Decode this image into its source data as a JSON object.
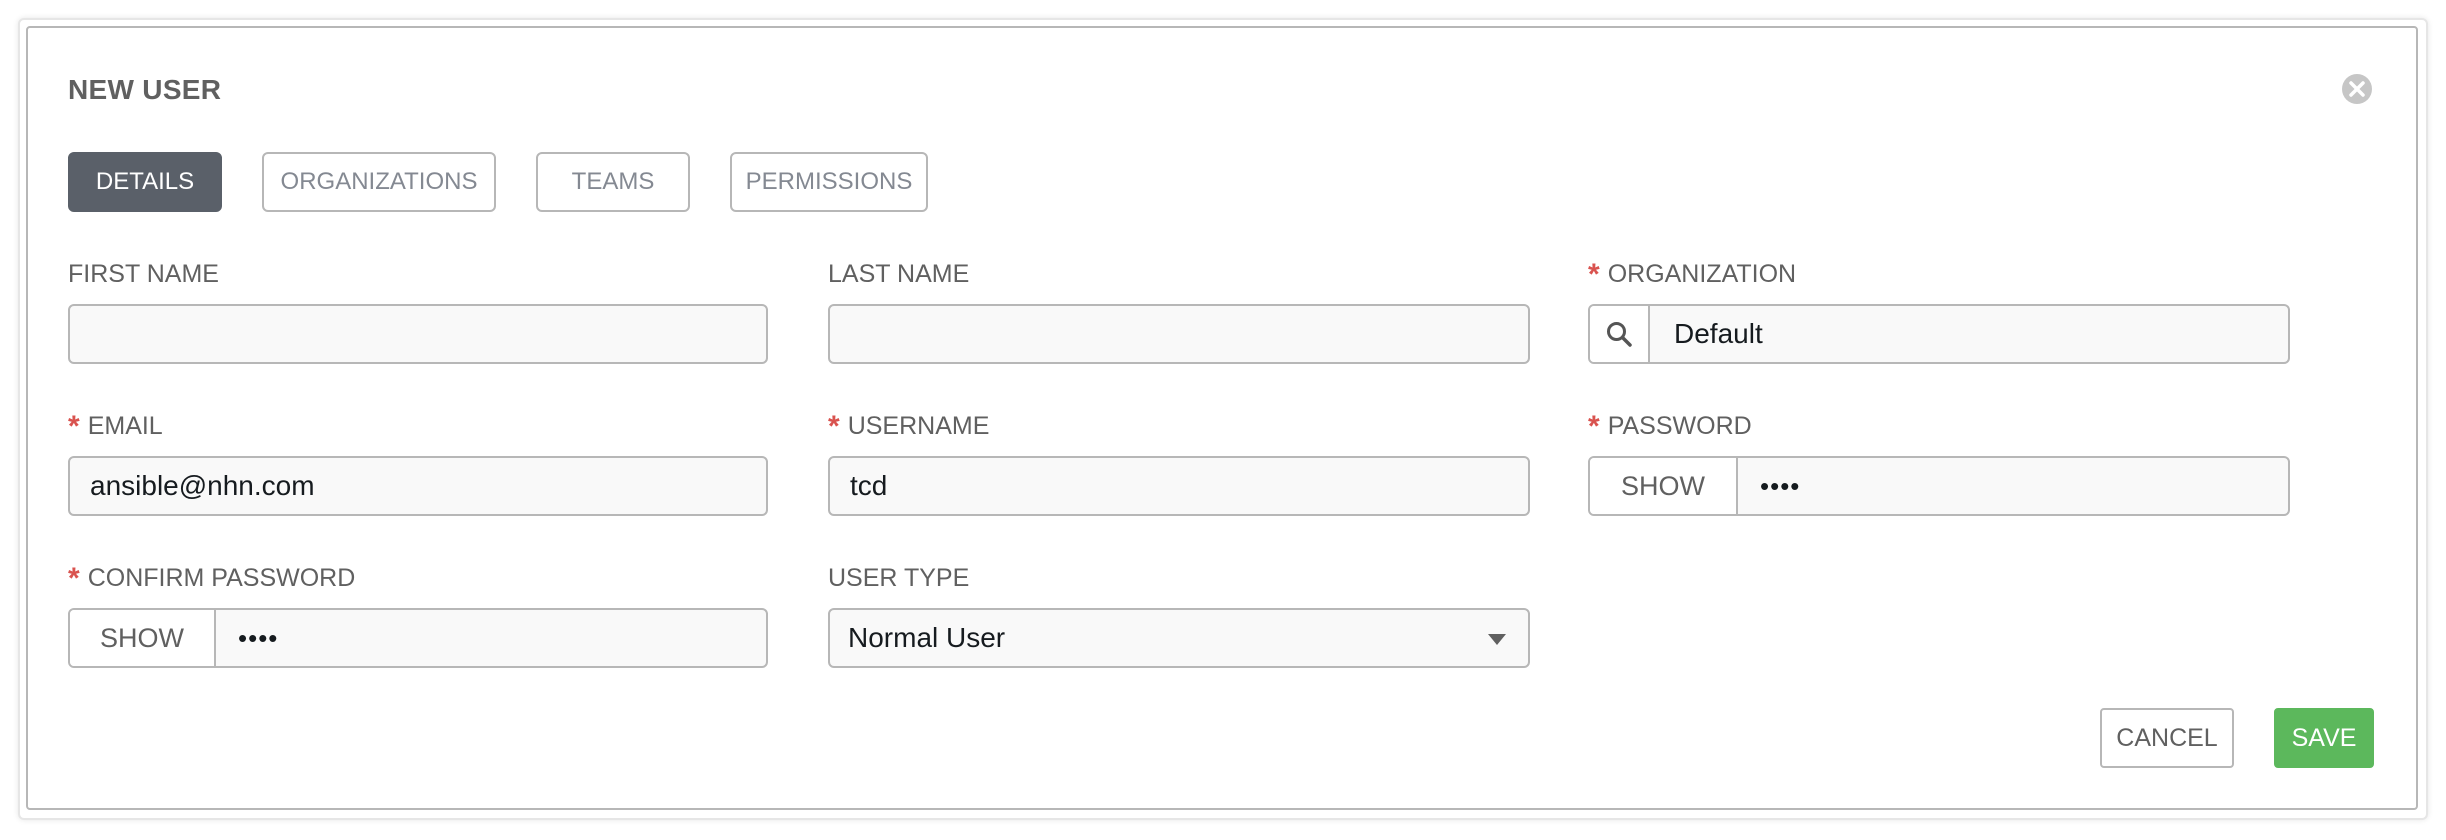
{
  "dialog": {
    "title": "NEW USER",
    "close_icon": "close-circle-icon"
  },
  "tabs": [
    {
      "label": "DETAILS",
      "active": true
    },
    {
      "label": "ORGANIZATIONS",
      "active": false
    },
    {
      "label": "TEAMS",
      "active": false
    },
    {
      "label": "PERMISSIONS",
      "active": false
    }
  ],
  "form": {
    "first_name": {
      "label": "FIRST NAME",
      "value": "",
      "required": false
    },
    "last_name": {
      "label": "LAST NAME",
      "value": "",
      "required": false
    },
    "organization": {
      "label": "ORGANIZATION",
      "value": "Default",
      "required": true,
      "icon": "search-icon"
    },
    "email": {
      "label": "EMAIL",
      "value": "ansible@nhn.com",
      "required": true
    },
    "username": {
      "label": "USERNAME",
      "value": "tcd",
      "required": true
    },
    "password": {
      "label": "PASSWORD",
      "show_label": "SHOW",
      "masked_value": "••••",
      "required": true
    },
    "confirm_password": {
      "label": "CONFIRM PASSWORD",
      "show_label": "SHOW",
      "masked_value": "••••",
      "required": true
    },
    "user_type": {
      "label": "USER TYPE",
      "value": "Normal User",
      "required": false
    }
  },
  "actions": {
    "cancel_label": "CANCEL",
    "save_label": "SAVE"
  },
  "colors": {
    "required": "#d9534f",
    "active_tab": "#5a6069",
    "save": "#5cb85c"
  }
}
